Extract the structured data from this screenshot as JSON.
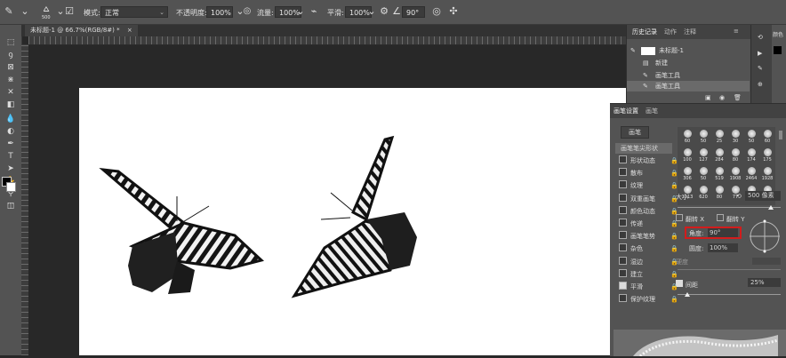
{
  "options_bar": {
    "brush_size": "500",
    "mode_label": "模式:",
    "mode_value": "正常",
    "opacity_label": "不透明度:",
    "opacity_value": "100%",
    "flow_label": "流量:",
    "flow_value": "100%",
    "smoothing_label": "平滑:",
    "smoothing_value": "100%",
    "angle_value": "90°"
  },
  "document_tab": {
    "title": "未标题-1 @ 66.7%(RGB/8#) *",
    "close": "×"
  },
  "history_panel": {
    "tabs": [
      "历史记录",
      "动作",
      "注释"
    ],
    "snapshot_name": "未标题-1",
    "items": [
      "新建",
      "画笔工具",
      "画笔工具"
    ]
  },
  "brush_panel": {
    "tabs": [
      "画笔设置",
      "画笔"
    ],
    "brushes_button": "画笔",
    "tip_shape_label": "画笔笔尖形状",
    "options": [
      {
        "label": "形状动态",
        "checked": false
      },
      {
        "label": "散布",
        "checked": false
      },
      {
        "label": "纹理",
        "checked": false
      },
      {
        "label": "双重画笔",
        "checked": false
      },
      {
        "label": "颜色动态",
        "checked": false
      },
      {
        "label": "传递",
        "checked": false
      },
      {
        "label": "画笔笔势",
        "checked": false
      },
      {
        "label": "杂色",
        "checked": false
      },
      {
        "label": "湿边",
        "checked": false
      },
      {
        "label": "建立",
        "checked": false
      },
      {
        "label": "平滑",
        "checked": true
      },
      {
        "label": "保护纹理",
        "checked": false
      }
    ],
    "tips": [
      [
        "60",
        "50",
        "25",
        "30",
        "50",
        "60"
      ],
      [
        "100",
        "127",
        "284",
        "80",
        "174",
        "175"
      ],
      [
        "306",
        "50",
        "519",
        "1908",
        "2464",
        "1928"
      ],
      [
        "1013",
        "620",
        "80",
        "77",
        "121",
        "105"
      ]
    ],
    "size_label": "大小",
    "size_value": "500 像素",
    "flip_x": "翻转 X",
    "flip_y": "翻转 Y",
    "angle_label": "角度:",
    "angle_value": "90°",
    "roundness_label": "圆度:",
    "roundness_value": "100%",
    "hardness_label": "硬度",
    "spacing_label": "间距",
    "spacing_value": "25%",
    "spacing_checked": true
  },
  "right_dock": {
    "label": "颜色"
  },
  "colors": {
    "accent_red": "#d21c1c"
  }
}
